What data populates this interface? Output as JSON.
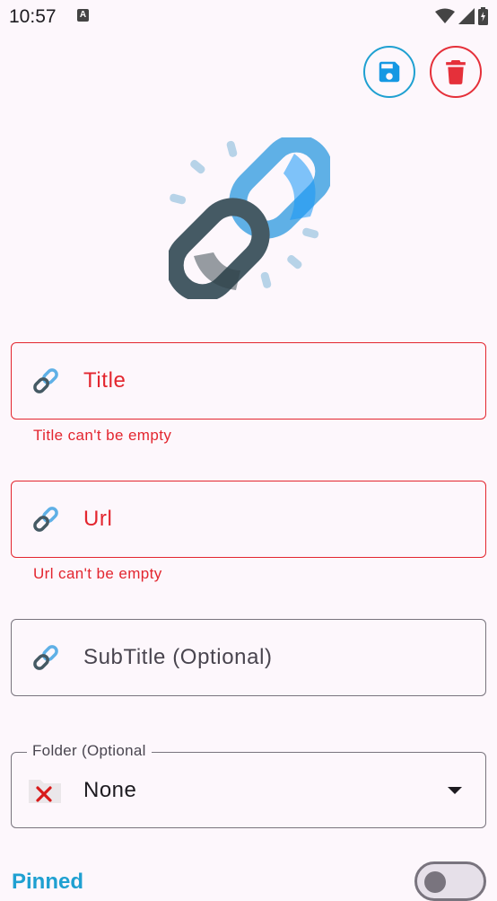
{
  "status": {
    "time": "10:57",
    "a_icon": "A"
  },
  "form": {
    "title": {
      "label": "Title",
      "error": "Title can't be empty"
    },
    "url": {
      "label": "Url",
      "error": "Url can't be empty"
    },
    "subtitle": {
      "label": "SubTitle (Optional)"
    },
    "folder": {
      "legend": "Folder (Optional",
      "value": "None"
    },
    "pinned": {
      "label": "Pinned",
      "checked": false
    }
  },
  "colors": {
    "accent": "#1fa0d1",
    "error": "#e3262f",
    "delete": "#e5303a",
    "background": "#fdf7fc"
  },
  "icons": {
    "save": "save-icon",
    "delete": "trash-icon",
    "hero": "link-chain-icon",
    "field": "link-chain-icon",
    "folder": "folder-x-icon",
    "dropdown": "caret-down-icon"
  }
}
